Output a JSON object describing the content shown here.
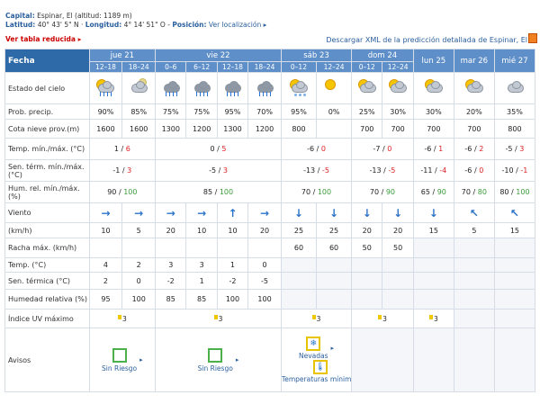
{
  "header": {
    "capital_label": "Capital:",
    "capital_value": "Espinar, El (altitud: 1189 m)",
    "lat_label": "Latitud:",
    "lat_value": "40° 43' 5\" N",
    "lon_label": "Longitud:",
    "lon_value": "4° 14' 51\" O",
    "sep": "-",
    "pos_label": "Posición:",
    "pos_link": "Ver localización ▸"
  },
  "links": {
    "reduced": "Ver tabla reducida ▸",
    "download": "Descargar XML de la predicción detallada de Espinar, El"
  },
  "table": {
    "fecha": "Fecha",
    "days": [
      "jue 21",
      "vie 22",
      "sáb 23",
      "dom 24",
      "lun 25",
      "mar 26",
      "mié 27"
    ],
    "periods": [
      "12–18",
      "18–24",
      "0–6",
      "6–12",
      "12–18",
      "18–24",
      "0–12",
      "12–24",
      "0–12",
      "12–24"
    ],
    "labels": {
      "sky": "Estado del cielo",
      "prob": "Prob. precip.",
      "cota": "Cota nieve prov.(m)",
      "temp": "Temp. mín./máx. (°C)",
      "sen": "Sen. térm. mín./máx. (°C)",
      "hum": "Hum. rel. mín./máx. (%)",
      "viento": "Viento",
      "kmh": "(km/h)",
      "racha": "Racha máx. (km/h)",
      "temp2": "Temp. (°C)",
      "sen2": "Sen. térmica (°C)",
      "hum2": "Humedad relativa (%)",
      "uv": "Índice UV máximo",
      "avisos": "Avisos"
    },
    "sky_icons": [
      "cloud-sun-rain-icon",
      "cloud-moon-icon",
      "cloud-rain-icon",
      "cloud-rain-icon",
      "cloud-rain-icon",
      "cloud-rain-icon",
      "cloud-snow-sun-icon",
      "sun-icon",
      "cloud-sun-icon",
      "cloud-sun-icon",
      "cloud-sun-icon",
      "cloud-sun-icon",
      "cloud-icon"
    ],
    "prob": [
      "90%",
      "85%",
      "75%",
      "75%",
      "95%",
      "70%",
      "95%",
      "0%",
      "25%",
      "30%",
      "30%",
      "20%",
      "35%"
    ],
    "cota": [
      "1600",
      "1600",
      "1300",
      "1200",
      "1300",
      "1200",
      "800",
      "",
      "700",
      "700",
      "700",
      "700",
      "800"
    ],
    "temp": [
      {
        "min": "1",
        "max": "6"
      },
      {
        "min": "0",
        "max": "5"
      },
      {
        "min": "-6",
        "max": "0"
      },
      {
        "min": "-7",
        "max": "0"
      },
      {
        "min": "-6",
        "max": "1"
      },
      {
        "min": "-6",
        "max": "2"
      },
      {
        "min": "-5",
        "max": "3"
      }
    ],
    "sen": [
      {
        "min": "-1",
        "max": "3"
      },
      {
        "min": "-5",
        "max": "3"
      },
      {
        "min": "-13",
        "max": "-5"
      },
      {
        "min": "-13",
        "max": "-5"
      },
      {
        "min": "-11",
        "max": "-4"
      },
      {
        "min": "-6",
        "max": "0"
      },
      {
        "min": "-10",
        "max": "-1"
      }
    ],
    "hum": [
      {
        "min": "90",
        "max": "100"
      },
      {
        "min": "85",
        "max": "100"
      },
      {
        "min": "70",
        "max": "100"
      },
      {
        "min": "70",
        "max": "90"
      },
      {
        "min": "65",
        "max": "90"
      },
      {
        "min": "70",
        "max": "80"
      },
      {
        "min": "80",
        "max": "100"
      }
    ],
    "wind_dir": [
      "→",
      "→",
      "→",
      "→",
      "↑",
      "→",
      "↓",
      "↓",
      "↓",
      "↓",
      "↓",
      "↖",
      "↖"
    ],
    "wind_kmh": [
      "10",
      "5",
      "20",
      "10",
      "10",
      "20",
      "25",
      "25",
      "20",
      "20",
      "15",
      "5",
      "15"
    ],
    "racha": [
      "",
      "",
      "",
      "",
      "",
      "",
      "60",
      "60",
      "50",
      "50"
    ],
    "temp2": [
      "4",
      "2",
      "3",
      "3",
      "1",
      "0"
    ],
    "sen2": [
      "2",
      "0",
      "-2",
      "1",
      "-2",
      "-5"
    ],
    "hum2": [
      "95",
      "100",
      "85",
      "85",
      "100",
      "100"
    ],
    "uv": [
      "3",
      "3",
      "3",
      "3",
      "3"
    ],
    "avisos": {
      "sin_riesgo": "Sin Riesgo",
      "nevadas": "Nevadas",
      "temp_min": "Temperaturas mínimas"
    }
  },
  "colors": {
    "header_blue": "#5f8fc9",
    "dark_blue": "#2f6aa8",
    "max_red": "#d22222",
    "max_green": "#3a9a3a"
  }
}
